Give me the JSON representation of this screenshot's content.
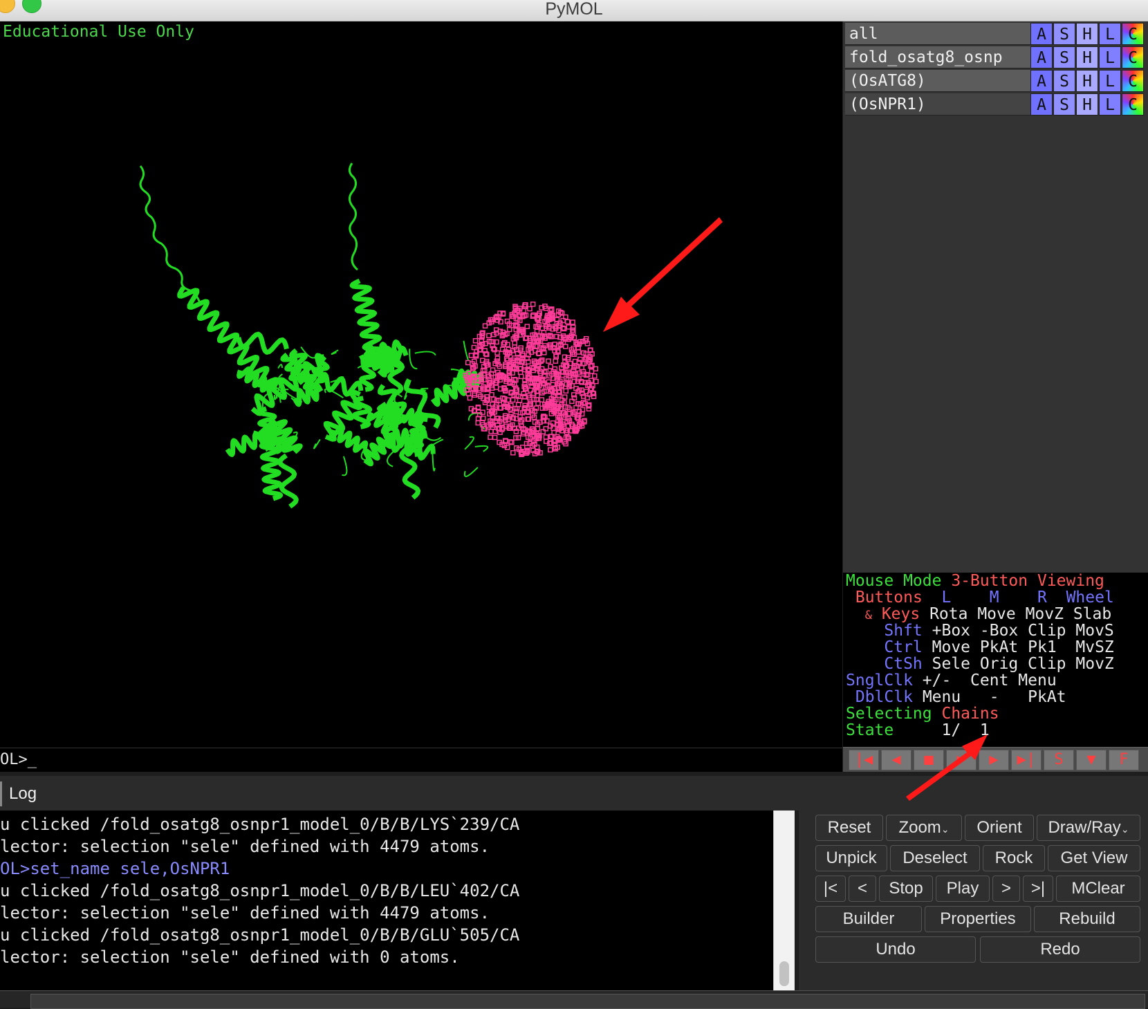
{
  "window": {
    "title": "PyMOL"
  },
  "viewer": {
    "watermark": "Educational Use Only",
    "command_prompt": "OL>_"
  },
  "objects": [
    {
      "name": "all",
      "buttons": [
        "A",
        "S",
        "H",
        "L",
        "C"
      ]
    },
    {
      "name": "fold_osatg8_osnp",
      "buttons": [
        "A",
        "S",
        "H",
        "L",
        "C"
      ]
    },
    {
      "name": "(OsATG8)",
      "buttons": [
        "A",
        "S",
        "H",
        "L",
        "C"
      ]
    },
    {
      "name": "(OsNPR1)",
      "buttons": [
        "A",
        "S",
        "H",
        "L",
        "C"
      ]
    }
  ],
  "mouse_mode": {
    "row1": {
      "label": "Mouse Mode",
      "mode": "3-Button Viewing"
    },
    "row2": {
      "label": "Buttons",
      "l": "L",
      "m": "M",
      "r": "R",
      "wheel": "Wheel"
    },
    "row3": {
      "amp": "&",
      "label": "Keys",
      "c1": "Rota",
      "c2": "Move",
      "c3": "MovZ",
      "c4": "Slab"
    },
    "row4": {
      "label": "Shft",
      "c1": "+Box",
      "c2": "-Box",
      "c3": "Clip",
      "c4": "MovS"
    },
    "row5": {
      "label": "Ctrl",
      "c1": "Move",
      "c2": "PkAt",
      "c3": "Pk1",
      "c4": "MvSZ"
    },
    "row6": {
      "label": "CtSh",
      "c1": "Sele",
      "c2": "Orig",
      "c3": "Clip",
      "c4": "MovZ"
    },
    "row7": {
      "label": "SnglClk",
      "c1": "+/-",
      "c2": "Cent",
      "c3": "Menu"
    },
    "row8": {
      "label": "DblClk",
      "c1": "Menu",
      "c2": "-",
      "c3": "PkAt"
    },
    "row9": {
      "label": "Selecting",
      "value": "Chains"
    },
    "row10": {
      "label": "State",
      "current": "1/",
      "total": "1"
    }
  },
  "playback": {
    "buttons": [
      "|◀",
      "◀",
      "■",
      "▶",
      "▶",
      "▶|",
      "S",
      "▼",
      "F"
    ]
  },
  "log": {
    "tab_label": "Log",
    "lines": [
      "u clicked /fold_osatg8_osnpr1_model_0/B/B/LYS`239/CA",
      "lector: selection \"sele\" defined with 4479 atoms.",
      "OL>set_name sele,OsNPR1",
      "u clicked /fold_osatg8_osnpr1_model_0/B/B/LEU`402/CA",
      "lector: selection \"sele\" defined with 4479 atoms.",
      "u clicked /fold_osatg8_osnpr1_model_0/B/B/GLU`505/CA",
      "lector: selection \"sele\" defined with 0 atoms."
    ]
  },
  "buttons": {
    "reset": "Reset",
    "zoom": "Zoom",
    "orient": "Orient",
    "draw_ray": "Draw/Ray",
    "unpick": "Unpick",
    "deselect": "Deselect",
    "rock": "Rock",
    "get_view": "Get View",
    "first": "|<",
    "prev": "<",
    "stop": "Stop",
    "play": "Play",
    "next": ">",
    "last": ">|",
    "mclear": "MClear",
    "builder": "Builder",
    "properties": "Properties",
    "rebuild": "Rebuild",
    "undo": "Undo",
    "redo": "Redo"
  },
  "colors": {
    "protein": "#22dd22",
    "selection": "#ff3c9a",
    "annotation_arrow": "#ff1a1a"
  }
}
